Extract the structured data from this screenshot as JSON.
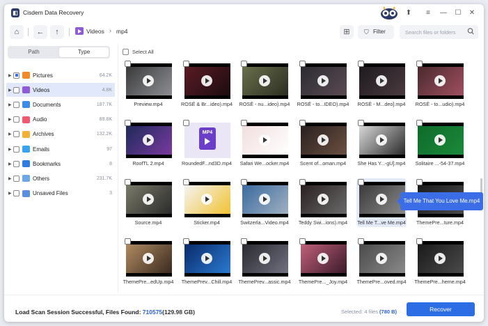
{
  "app": {
    "title": "Cisdem Data Recovery"
  },
  "titlebar_buttons": [
    {
      "name": "upgrade-icon",
      "glyph": "⬆"
    },
    {
      "name": "menu-icon",
      "glyph": "≡"
    },
    {
      "name": "minimize-icon",
      "glyph": "—"
    },
    {
      "name": "maximize-icon",
      "glyph": "☐"
    },
    {
      "name": "close-icon",
      "glyph": "✕"
    }
  ],
  "toolbar": {
    "breadcrumb": {
      "folder": "Videos",
      "separator": "›",
      "current": "mp4"
    },
    "filter_label": "Filter",
    "search_placeholder": "Search files or folders"
  },
  "sidebar": {
    "tabs": [
      {
        "label": "Path",
        "active": false
      },
      {
        "label": "Type",
        "active": true
      }
    ],
    "categories": [
      {
        "label": "Pictures",
        "count": "64.2K",
        "icon_color": "#f28a2b",
        "icon": "pictures-icon",
        "selected": false,
        "partial": true
      },
      {
        "label": "Videos",
        "count": "4.8K",
        "icon_color": "#8e5bd8",
        "icon": "videos-icon",
        "selected": true,
        "partial": false
      },
      {
        "label": "Documents",
        "count": "187.7K",
        "icon_color": "#3b8de7",
        "icon": "documents-icon",
        "selected": false,
        "partial": false
      },
      {
        "label": "Audio",
        "count": "89.8K",
        "icon_color": "#ef5a6f",
        "icon": "audio-icon",
        "selected": false,
        "partial": false
      },
      {
        "label": "Archives",
        "count": "132.2K",
        "icon_color": "#f2b035",
        "icon": "archives-icon",
        "selected": false,
        "partial": false
      },
      {
        "label": "Emails",
        "count": "97",
        "icon_color": "#3aa3f0",
        "icon": "emails-icon",
        "selected": false,
        "partial": false
      },
      {
        "label": "Bookmarks",
        "count": "8",
        "icon_color": "#2f7de1",
        "icon": "bookmarks-icon",
        "selected": false,
        "partial": false
      },
      {
        "label": "Others",
        "count": "231.7K",
        "icon_color": "#6aa8e8",
        "icon": "others-icon",
        "selected": false,
        "partial": false
      },
      {
        "label": "Unsaved Files",
        "count": "3",
        "icon_color": "#5b8de0",
        "icon": "unsaved-files-icon",
        "selected": false,
        "partial": false
      }
    ]
  },
  "main": {
    "select_all_label": "Select All",
    "files": [
      {
        "name": "Preview.mp4",
        "colors": [
          "#3a3a3a",
          "#8d8f95"
        ]
      },
      {
        "name": "ROSÉ & Br...ideo).mp4",
        "colors": [
          "#5a1b24",
          "#1b0c10"
        ]
      },
      {
        "name": "ROSÉ - nu...ideo).mp4",
        "colors": [
          "#6a6f4c",
          "#2b2e20"
        ]
      },
      {
        "name": "ROSÉ - to...IDEO).mp4",
        "colors": [
          "#2c2b33",
          "#5b4a52"
        ]
      },
      {
        "name": "ROSÉ - M...deo].mp4",
        "colors": [
          "#1e1a1f",
          "#4a3a3f"
        ]
      },
      {
        "name": "ROSÉ - to...udio).mp4",
        "colors": [
          "#4a2a2e",
          "#a05060"
        ]
      },
      {
        "name": "RoofTL 2.mp4",
        "colors": [
          "#1e2a5a",
          "#7a3aa0"
        ]
      },
      {
        "name": "RoundedF...nd3D.mp4",
        "colors": [
          "#eae6f6",
          "#eae6f6"
        ],
        "special": "mp4-file"
      },
      {
        "name": "Safari We...ocker.mp4",
        "colors": [
          "#f2dede",
          "#ffffff"
        ]
      },
      {
        "name": "Scent of...oman.mp4",
        "colors": [
          "#2a2020",
          "#6a5040"
        ]
      },
      {
        "name": "She Has Y...-gU].mp4",
        "colors": [
          "#d8d8d8",
          "#2a2a2a"
        ]
      },
      {
        "name": "Solitaire ...-54-37.mp4",
        "colors": [
          "#0f6a2a",
          "#1a8a3a"
        ]
      },
      {
        "name": "Source.mp4",
        "colors": [
          "#7a7a6a",
          "#2a2a2a"
        ]
      },
      {
        "name": "Sticker.mp4",
        "colors": [
          "#f4f4f4",
          "#f2c230"
        ]
      },
      {
        "name": "Switzerla...Video.mp4",
        "colors": [
          "#3a6aa0",
          "#a0b0c0"
        ]
      },
      {
        "name": "Teddy Swi...ions).mp4",
        "colors": [
          "#2a2020",
          "#6a6a6a"
        ]
      },
      {
        "name": "Tell Me T...ve Me.mp4",
        "colors": [
          "#3a3a3a",
          "#8a8a8a"
        ],
        "hover": true
      },
      {
        "name": "ThemePre...ture.mp4",
        "colors": [
          "#1a1a1a",
          "#4a4a4a"
        ]
      },
      {
        "name": "ThemePre...edUp.mp4",
        "colors": [
          "#b08a60",
          "#3a2a20"
        ]
      },
      {
        "name": "ThemePrev...Chill.mp4",
        "colors": [
          "#0a2a6a",
          "#2a7ad0"
        ]
      },
      {
        "name": "ThemePrev...assic.mp4",
        "colors": [
          "#2a2a30",
          "#707080"
        ]
      },
      {
        "name": "ThemePre..._Joy.mp4",
        "colors": [
          "#c0607a",
          "#3a1a2a"
        ]
      },
      {
        "name": "ThemePre...oved.mp4",
        "colors": [
          "#4a4a4a",
          "#8a8a8a"
        ]
      },
      {
        "name": "ThemePre...heme.mp4",
        "colors": [
          "#1a1a1a",
          "#4a4a4a"
        ]
      }
    ],
    "tooltip": "Tell Me That You Love Me.mp4"
  },
  "footer": {
    "status_prefix": "Load Scan Session Successful, Files Found: ",
    "files_found": "710575",
    "size": "(129.98 GB)",
    "selected_prefix": "Selected: 4 files ",
    "selected_size": "(780 B)",
    "recover_label": "Recover"
  }
}
